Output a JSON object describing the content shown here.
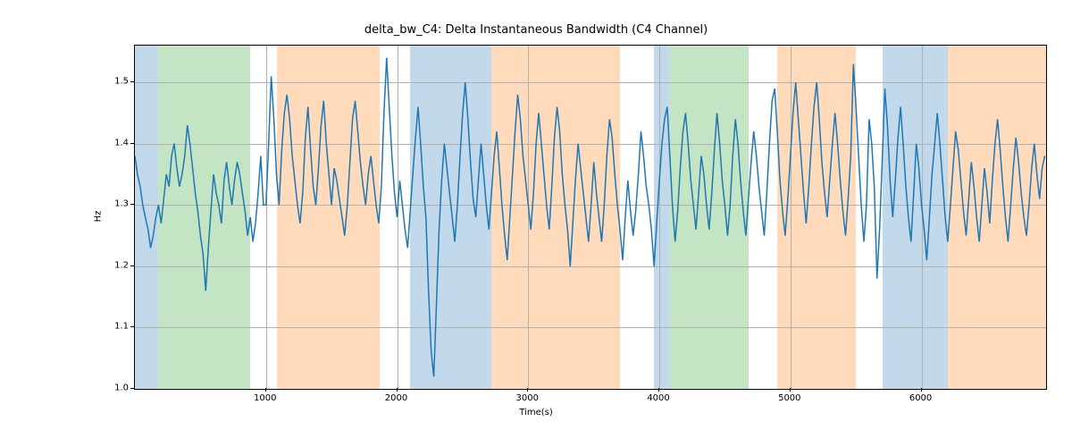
{
  "chart_data": {
    "type": "line",
    "title": "delta_bw_C4: Delta Instantaneous Bandwidth (C4 Channel)",
    "xlabel": "Time(s)",
    "ylabel": "Hz",
    "xlim": [
      0,
      6950
    ],
    "ylim": [
      1.0,
      1.56
    ],
    "xticks": [
      1000,
      2000,
      3000,
      4000,
      5000,
      6000
    ],
    "yticks": [
      1.0,
      1.1,
      1.2,
      1.3,
      1.4,
      1.5
    ],
    "spans": [
      {
        "x0": 0,
        "x1": 180,
        "color": "#1f77b4"
      },
      {
        "x0": 180,
        "x1": 880,
        "color": "#2ca02c"
      },
      {
        "x0": 1080,
        "x1": 1870,
        "color": "#ff7f0e"
      },
      {
        "x0": 2100,
        "x1": 2720,
        "color": "#1f77b4"
      },
      {
        "x0": 2720,
        "x1": 3700,
        "color": "#ff7f0e"
      },
      {
        "x0": 3960,
        "x1": 4080,
        "color": "#1f77b4"
      },
      {
        "x0": 4080,
        "x1": 4680,
        "color": "#2ca02c"
      },
      {
        "x0": 4900,
        "x1": 5500,
        "color": "#ff7f0e"
      },
      {
        "x0": 5700,
        "x1": 6200,
        "color": "#1f77b4"
      },
      {
        "x0": 6200,
        "x1": 6950,
        "color": "#ff7f0e"
      }
    ],
    "x": [
      0,
      20,
      40,
      60,
      80,
      100,
      120,
      140,
      160,
      180,
      200,
      220,
      240,
      260,
      280,
      300,
      320,
      340,
      360,
      380,
      400,
      420,
      440,
      460,
      480,
      500,
      520,
      540,
      560,
      580,
      600,
      620,
      640,
      660,
      680,
      700,
      720,
      740,
      760,
      780,
      800,
      820,
      840,
      860,
      880,
      900,
      920,
      940,
      960,
      980,
      1000,
      1020,
      1040,
      1060,
      1080,
      1100,
      1120,
      1140,
      1160,
      1180,
      1200,
      1220,
      1240,
      1260,
      1280,
      1300,
      1320,
      1340,
      1360,
      1380,
      1400,
      1420,
      1440,
      1460,
      1480,
      1500,
      1520,
      1540,
      1560,
      1580,
      1600,
      1620,
      1640,
      1660,
      1680,
      1700,
      1720,
      1740,
      1760,
      1780,
      1800,
      1820,
      1840,
      1860,
      1880,
      1900,
      1920,
      1940,
      1960,
      1980,
      2000,
      2020,
      2040,
      2060,
      2080,
      2100,
      2120,
      2140,
      2160,
      2180,
      2200,
      2220,
      2240,
      2260,
      2280,
      2300,
      2320,
      2340,
      2360,
      2380,
      2400,
      2420,
      2440,
      2460,
      2480,
      2500,
      2520,
      2540,
      2560,
      2580,
      2600,
      2620,
      2640,
      2660,
      2680,
      2700,
      2720,
      2740,
      2760,
      2780,
      2800,
      2820,
      2840,
      2860,
      2880,
      2900,
      2920,
      2940,
      2960,
      2980,
      3000,
      3020,
      3040,
      3060,
      3080,
      3100,
      3120,
      3140,
      3160,
      3180,
      3200,
      3220,
      3240,
      3260,
      3280,
      3300,
      3320,
      3340,
      3360,
      3380,
      3400,
      3420,
      3440,
      3460,
      3480,
      3500,
      3520,
      3540,
      3560,
      3580,
      3600,
      3620,
      3640,
      3660,
      3680,
      3700,
      3720,
      3740,
      3760,
      3780,
      3800,
      3820,
      3840,
      3860,
      3880,
      3900,
      3920,
      3940,
      3960,
      3980,
      4000,
      4020,
      4040,
      4060,
      4080,
      4100,
      4120,
      4140,
      4160,
      4180,
      4200,
      4220,
      4240,
      4260,
      4280,
      4300,
      4320,
      4340,
      4360,
      4380,
      4400,
      4420,
      4440,
      4460,
      4480,
      4500,
      4520,
      4540,
      4560,
      4580,
      4600,
      4620,
      4640,
      4660,
      4680,
      4700,
      4720,
      4740,
      4760,
      4780,
      4800,
      4820,
      4840,
      4860,
      4880,
      4900,
      4920,
      4940,
      4960,
      4980,
      5000,
      5020,
      5040,
      5060,
      5080,
      5100,
      5120,
      5140,
      5160,
      5180,
      5200,
      5220,
      5240,
      5260,
      5280,
      5300,
      5320,
      5340,
      5360,
      5380,
      5400,
      5420,
      5440,
      5460,
      5480,
      5500,
      5520,
      5540,
      5560,
      5580,
      5600,
      5620,
      5640,
      5660,
      5680,
      5700,
      5720,
      5740,
      5760,
      5780,
      5800,
      5820,
      5840,
      5860,
      5880,
      5900,
      5920,
      5940,
      5960,
      5980,
      6000,
      6020,
      6040,
      6060,
      6080,
      6100,
      6120,
      6140,
      6160,
      6180,
      6200,
      6220,
      6240,
      6260,
      6280,
      6300,
      6320,
      6340,
      6360,
      6380,
      6400,
      6420,
      6440,
      6460,
      6480,
      6500,
      6520,
      6540,
      6560,
      6580,
      6600,
      6620,
      6640,
      6660,
      6680,
      6700,
      6720,
      6740,
      6760,
      6780,
      6800,
      6820,
      6840,
      6860,
      6880,
      6900,
      6920,
      6940
    ],
    "values": [
      1.38,
      1.35,
      1.33,
      1.3,
      1.28,
      1.26,
      1.23,
      1.25,
      1.28,
      1.3,
      1.27,
      1.31,
      1.35,
      1.33,
      1.38,
      1.4,
      1.36,
      1.33,
      1.35,
      1.38,
      1.43,
      1.4,
      1.36,
      1.32,
      1.29,
      1.25,
      1.22,
      1.16,
      1.23,
      1.29,
      1.35,
      1.32,
      1.3,
      1.27,
      1.34,
      1.37,
      1.33,
      1.3,
      1.34,
      1.37,
      1.35,
      1.32,
      1.29,
      1.25,
      1.28,
      1.24,
      1.27,
      1.32,
      1.38,
      1.3,
      1.3,
      1.4,
      1.51,
      1.44,
      1.35,
      1.3,
      1.39,
      1.45,
      1.48,
      1.44,
      1.38,
      1.34,
      1.3,
      1.27,
      1.32,
      1.41,
      1.46,
      1.39,
      1.33,
      1.3,
      1.36,
      1.43,
      1.47,
      1.4,
      1.35,
      1.3,
      1.36,
      1.34,
      1.31,
      1.28,
      1.25,
      1.3,
      1.37,
      1.44,
      1.47,
      1.42,
      1.37,
      1.33,
      1.3,
      1.35,
      1.38,
      1.34,
      1.3,
      1.27,
      1.33,
      1.45,
      1.54,
      1.46,
      1.38,
      1.32,
      1.28,
      1.34,
      1.3,
      1.26,
      1.23,
      1.29,
      1.35,
      1.41,
      1.46,
      1.4,
      1.33,
      1.28,
      1.16,
      1.06,
      1.02,
      1.14,
      1.26,
      1.34,
      1.4,
      1.36,
      1.32,
      1.28,
      1.24,
      1.3,
      1.38,
      1.45,
      1.5,
      1.44,
      1.37,
      1.31,
      1.28,
      1.34,
      1.4,
      1.35,
      1.3,
      1.26,
      1.32,
      1.38,
      1.42,
      1.36,
      1.3,
      1.25,
      1.21,
      1.28,
      1.35,
      1.42,
      1.48,
      1.44,
      1.38,
      1.34,
      1.3,
      1.26,
      1.32,
      1.4,
      1.45,
      1.4,
      1.35,
      1.3,
      1.26,
      1.33,
      1.41,
      1.46,
      1.42,
      1.35,
      1.3,
      1.26,
      1.2,
      1.27,
      1.34,
      1.4,
      1.36,
      1.32,
      1.28,
      1.24,
      1.3,
      1.37,
      1.32,
      1.28,
      1.24,
      1.3,
      1.38,
      1.44,
      1.41,
      1.35,
      1.3,
      1.26,
      1.21,
      1.28,
      1.34,
      1.29,
      1.25,
      1.29,
      1.35,
      1.42,
      1.38,
      1.33,
      1.3,
      1.26,
      1.2,
      1.27,
      1.34,
      1.4,
      1.44,
      1.46,
      1.38,
      1.3,
      1.24,
      1.29,
      1.36,
      1.42,
      1.45,
      1.4,
      1.34,
      1.3,
      1.26,
      1.32,
      1.38,
      1.35,
      1.3,
      1.26,
      1.32,
      1.39,
      1.45,
      1.4,
      1.34,
      1.3,
      1.25,
      1.3,
      1.38,
      1.44,
      1.4,
      1.34,
      1.29,
      1.25,
      1.31,
      1.37,
      1.42,
      1.38,
      1.33,
      1.29,
      1.25,
      1.32,
      1.4,
      1.47,
      1.49,
      1.42,
      1.34,
      1.29,
      1.25,
      1.31,
      1.38,
      1.45,
      1.5,
      1.44,
      1.38,
      1.32,
      1.27,
      1.33,
      1.4,
      1.46,
      1.5,
      1.44,
      1.37,
      1.32,
      1.28,
      1.34,
      1.4,
      1.45,
      1.4,
      1.34,
      1.29,
      1.25,
      1.31,
      1.38,
      1.53,
      1.46,
      1.38,
      1.3,
      1.24,
      1.3,
      1.44,
      1.4,
      1.33,
      1.18,
      1.26,
      1.37,
      1.49,
      1.43,
      1.34,
      1.28,
      1.34,
      1.41,
      1.46,
      1.4,
      1.33,
      1.28,
      1.24,
      1.32,
      1.4,
      1.36,
      1.3,
      1.26,
      1.21,
      1.28,
      1.35,
      1.4,
      1.45,
      1.4,
      1.34,
      1.28,
      1.24,
      1.3,
      1.36,
      1.42,
      1.39,
      1.34,
      1.29,
      1.25,
      1.31,
      1.37,
      1.33,
      1.28,
      1.24,
      1.3,
      1.36,
      1.32,
      1.27,
      1.34,
      1.4,
      1.44,
      1.39,
      1.33,
      1.28,
      1.24,
      1.3,
      1.36,
      1.41,
      1.37,
      1.32,
      1.28,
      1.25,
      1.3,
      1.36,
      1.4,
      1.35,
      1.31,
      1.36,
      1.38
    ]
  }
}
